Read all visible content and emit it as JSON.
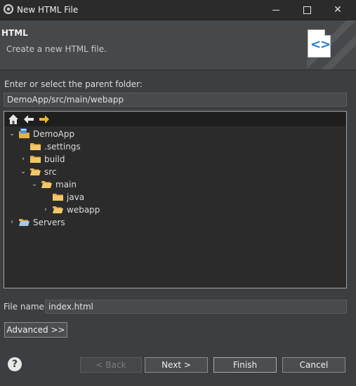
{
  "window": {
    "title": "New HTML File",
    "controls": {
      "minimize": "minimize",
      "maximize": "maximize",
      "close": "✕"
    }
  },
  "header": {
    "title": "HTML",
    "description": "Create a new HTML file.",
    "badge_icon": "html-file-icon"
  },
  "parent_folder": {
    "label": "Enter or select the parent folder:",
    "value": "DemoApp/src/main/webapp"
  },
  "tree": {
    "toolbar": [
      "home-icon",
      "back-arrow-icon",
      "forward-arrow-icon"
    ],
    "items": [
      {
        "label": "DemoApp",
        "expanded": true
      },
      {
        "label": ".settings",
        "expanded": false
      },
      {
        "label": "build",
        "expanded": false
      },
      {
        "label": "src",
        "expanded": true
      },
      {
        "label": "main",
        "expanded": true
      },
      {
        "label": "java",
        "expanded": false
      },
      {
        "label": "webapp",
        "expanded": false
      },
      {
        "label": "Servers",
        "expanded": false
      }
    ]
  },
  "file_name": {
    "label": "File name:",
    "value": "index.html"
  },
  "advanced": {
    "label": "Advanced >>"
  },
  "buttons": {
    "back": "< Back",
    "next": "Next >",
    "finish": "Finish",
    "cancel": "Cancel",
    "help": "?"
  },
  "colors": {
    "dialog_bg": "#3c3f41",
    "tree_bg": "#2b2b2b",
    "folder": "#e8b04a",
    "accent": "#1e7ad7"
  }
}
